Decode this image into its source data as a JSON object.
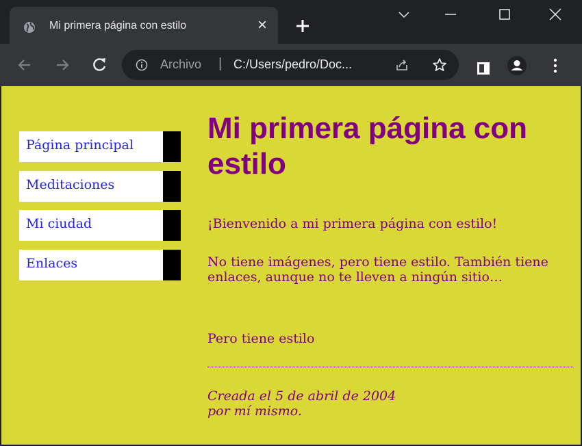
{
  "browser": {
    "tab_title": "Mi primera página con estilo",
    "tab_close": "×",
    "url_scheme": "Archivo",
    "url_separator": "|",
    "url": "C:/Users/pedro/Doc...",
    "icons": [
      "globe-icon",
      "plus-icon",
      "chevron-down-icon",
      "minimize-icon",
      "maximize-icon",
      "close-icon",
      "back-arrow-icon",
      "forward-arrow-icon",
      "reload-icon",
      "info-icon",
      "share-icon",
      "star-icon",
      "side-panel-icon",
      "profile-icon",
      "kebab-menu-icon"
    ]
  },
  "page": {
    "nav": [
      {
        "label": "Página principal"
      },
      {
        "label": "Meditaciones"
      },
      {
        "label": "Mi ciudad"
      },
      {
        "label": "Enlaces"
      }
    ],
    "heading": "Mi primera página con estilo",
    "paragraphs": [
      "¡Bienvenido a mi primera página con estilo!",
      "No tiene imágenes, pero tiene estilo. También tiene enlaces, aunque no te lleven a ningún sitio…",
      "Pero tiene estilo"
    ],
    "footer_line1": "Creada el 5 de abril de 2004",
    "footer_line2": "por mí mismo."
  },
  "colors": {
    "page_background": "#d9d836",
    "text": "#800080",
    "link": "#2222ee",
    "nav_border": "#000000",
    "chrome_dark": "#202124",
    "chrome_toolbar": "#35363a"
  }
}
